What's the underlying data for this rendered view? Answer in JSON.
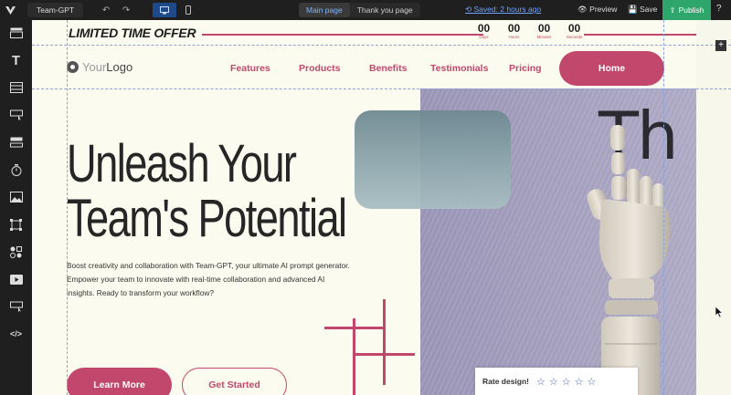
{
  "toolbar": {
    "project_name": "Team-GPT",
    "pages": [
      "Main page",
      "Thank you page"
    ],
    "saved_label": "Saved: 2 hours ago",
    "preview_label": "Preview",
    "save_label": "Save",
    "publish_label": "Publish",
    "help_label": "?"
  },
  "offer": {
    "title": "LIMITED TIME OFFER",
    "countdown": [
      {
        "value": "00",
        "label": "Days"
      },
      {
        "value": "00",
        "label": "Hours"
      },
      {
        "value": "00",
        "label": "Minutes"
      },
      {
        "value": "00",
        "label": "Seconds"
      }
    ]
  },
  "nav": {
    "brand_your": "Your",
    "brand_logo": "Logo",
    "links": [
      "Features",
      "Products",
      "Benefits",
      "Testimonials",
      "Pricing"
    ],
    "home_label": "Home"
  },
  "hero": {
    "title": "Unleash Your Team's Potential",
    "description": "Boost creativity and collaboration with Team-GPT, your ultimate AI prompt generator. Empower your team to innovate with real-time collaboration and advanced AI insights. Ready to transform your workflow?",
    "image_text": "Th",
    "learn_label": "Learn More",
    "start_label": "Get Started"
  },
  "rating": {
    "label": "Rate design!",
    "stars": [
      "☆",
      "☆",
      "☆",
      "☆",
      "☆"
    ]
  },
  "colors": {
    "accent": "#c2476c",
    "publish": "#2ea56b",
    "background": "#fbfbf0"
  }
}
